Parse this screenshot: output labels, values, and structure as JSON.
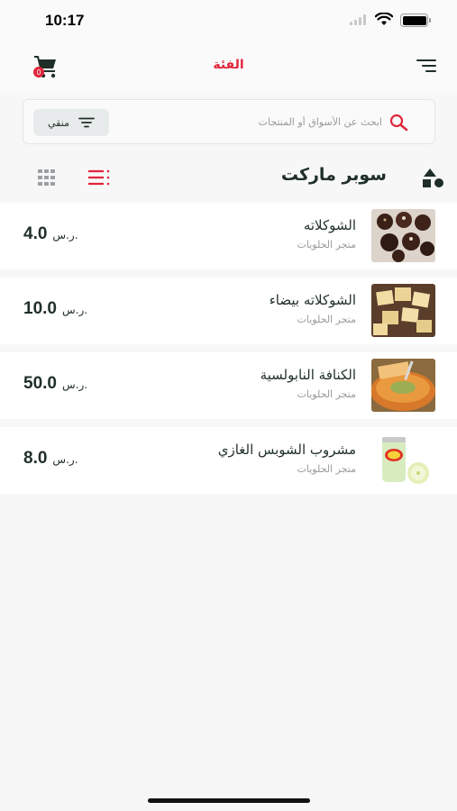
{
  "status_bar": {
    "time": "10:17"
  },
  "nav": {
    "title": "الفئة",
    "cart_badge": "0"
  },
  "search": {
    "placeholder": "ابحث عن الأسواق أو المنتجات",
    "filter_label": "منقي"
  },
  "section": {
    "title": "سوبر ماركت"
  },
  "products": [
    {
      "name": "الشوكلاته",
      "store": "متجر الحلويات",
      "price": "4.0",
      "currency": "ر.س."
    },
    {
      "name": "الشوكلاته بيضاء",
      "store": "متجر الحلويات",
      "price": "10.0",
      "currency": "ر.س."
    },
    {
      "name": "الكنافة النابولسية",
      "store": "متجر الحلويات",
      "price": "50.0",
      "currency": "ر.س."
    },
    {
      "name": "مشروب الشوبس الغازي",
      "store": "متجر الحلويات",
      "price": "8.0",
      "currency": "ر.س."
    }
  ],
  "colors": {
    "accent": "#e0263c",
    "primary_text": "#1f2f28",
    "secondary_text": "#9b9b9b"
  },
  "icons": [
    "cart-icon",
    "menu-icon",
    "search-icon",
    "filter-icon",
    "grid-view-icon",
    "list-view-icon",
    "shapes-icon"
  ]
}
